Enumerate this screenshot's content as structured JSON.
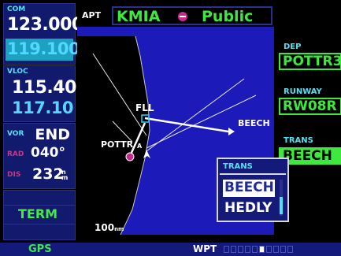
{
  "com": {
    "label": "COM",
    "active": "123.000",
    "standby": "119.100"
  },
  "vloc": {
    "label": "VLOC",
    "active": "115.40",
    "standby": "117.10"
  },
  "vor": {
    "label": "VOR",
    "status": "END",
    "rad_label": "RAD",
    "rad_value": "040°",
    "dis_label": "DIS",
    "dis_value": "232",
    "dis_unit": "nm"
  },
  "mode": {
    "label": "TERM"
  },
  "header": {
    "label": "APT",
    "identifier": "KMIA",
    "type": "Public"
  },
  "map": {
    "waypoints": [
      "FLL",
      "BEECH",
      "POTTR",
      "A"
    ],
    "range": "100",
    "range_unit": "nm"
  },
  "right_panel": {
    "dep_label": "DEP",
    "dep_value": "POTTR3",
    "runway_label": "RUNWAY",
    "runway_value": "RW08R",
    "trans_label": "TRANS",
    "trans_value": "BEECH"
  },
  "popup": {
    "title": "TRANS",
    "options": [
      "BEECH",
      "HEDLY"
    ],
    "selected": "BEECH"
  },
  "bottom": {
    "left": "GPS",
    "mode": "WPT",
    "page_count": 10,
    "current_page": 6
  },
  "colors": {
    "panel": "#121a6e",
    "map_water": "#1c1ab8",
    "accent": "#3fe83f",
    "label": "#55e0f2"
  }
}
